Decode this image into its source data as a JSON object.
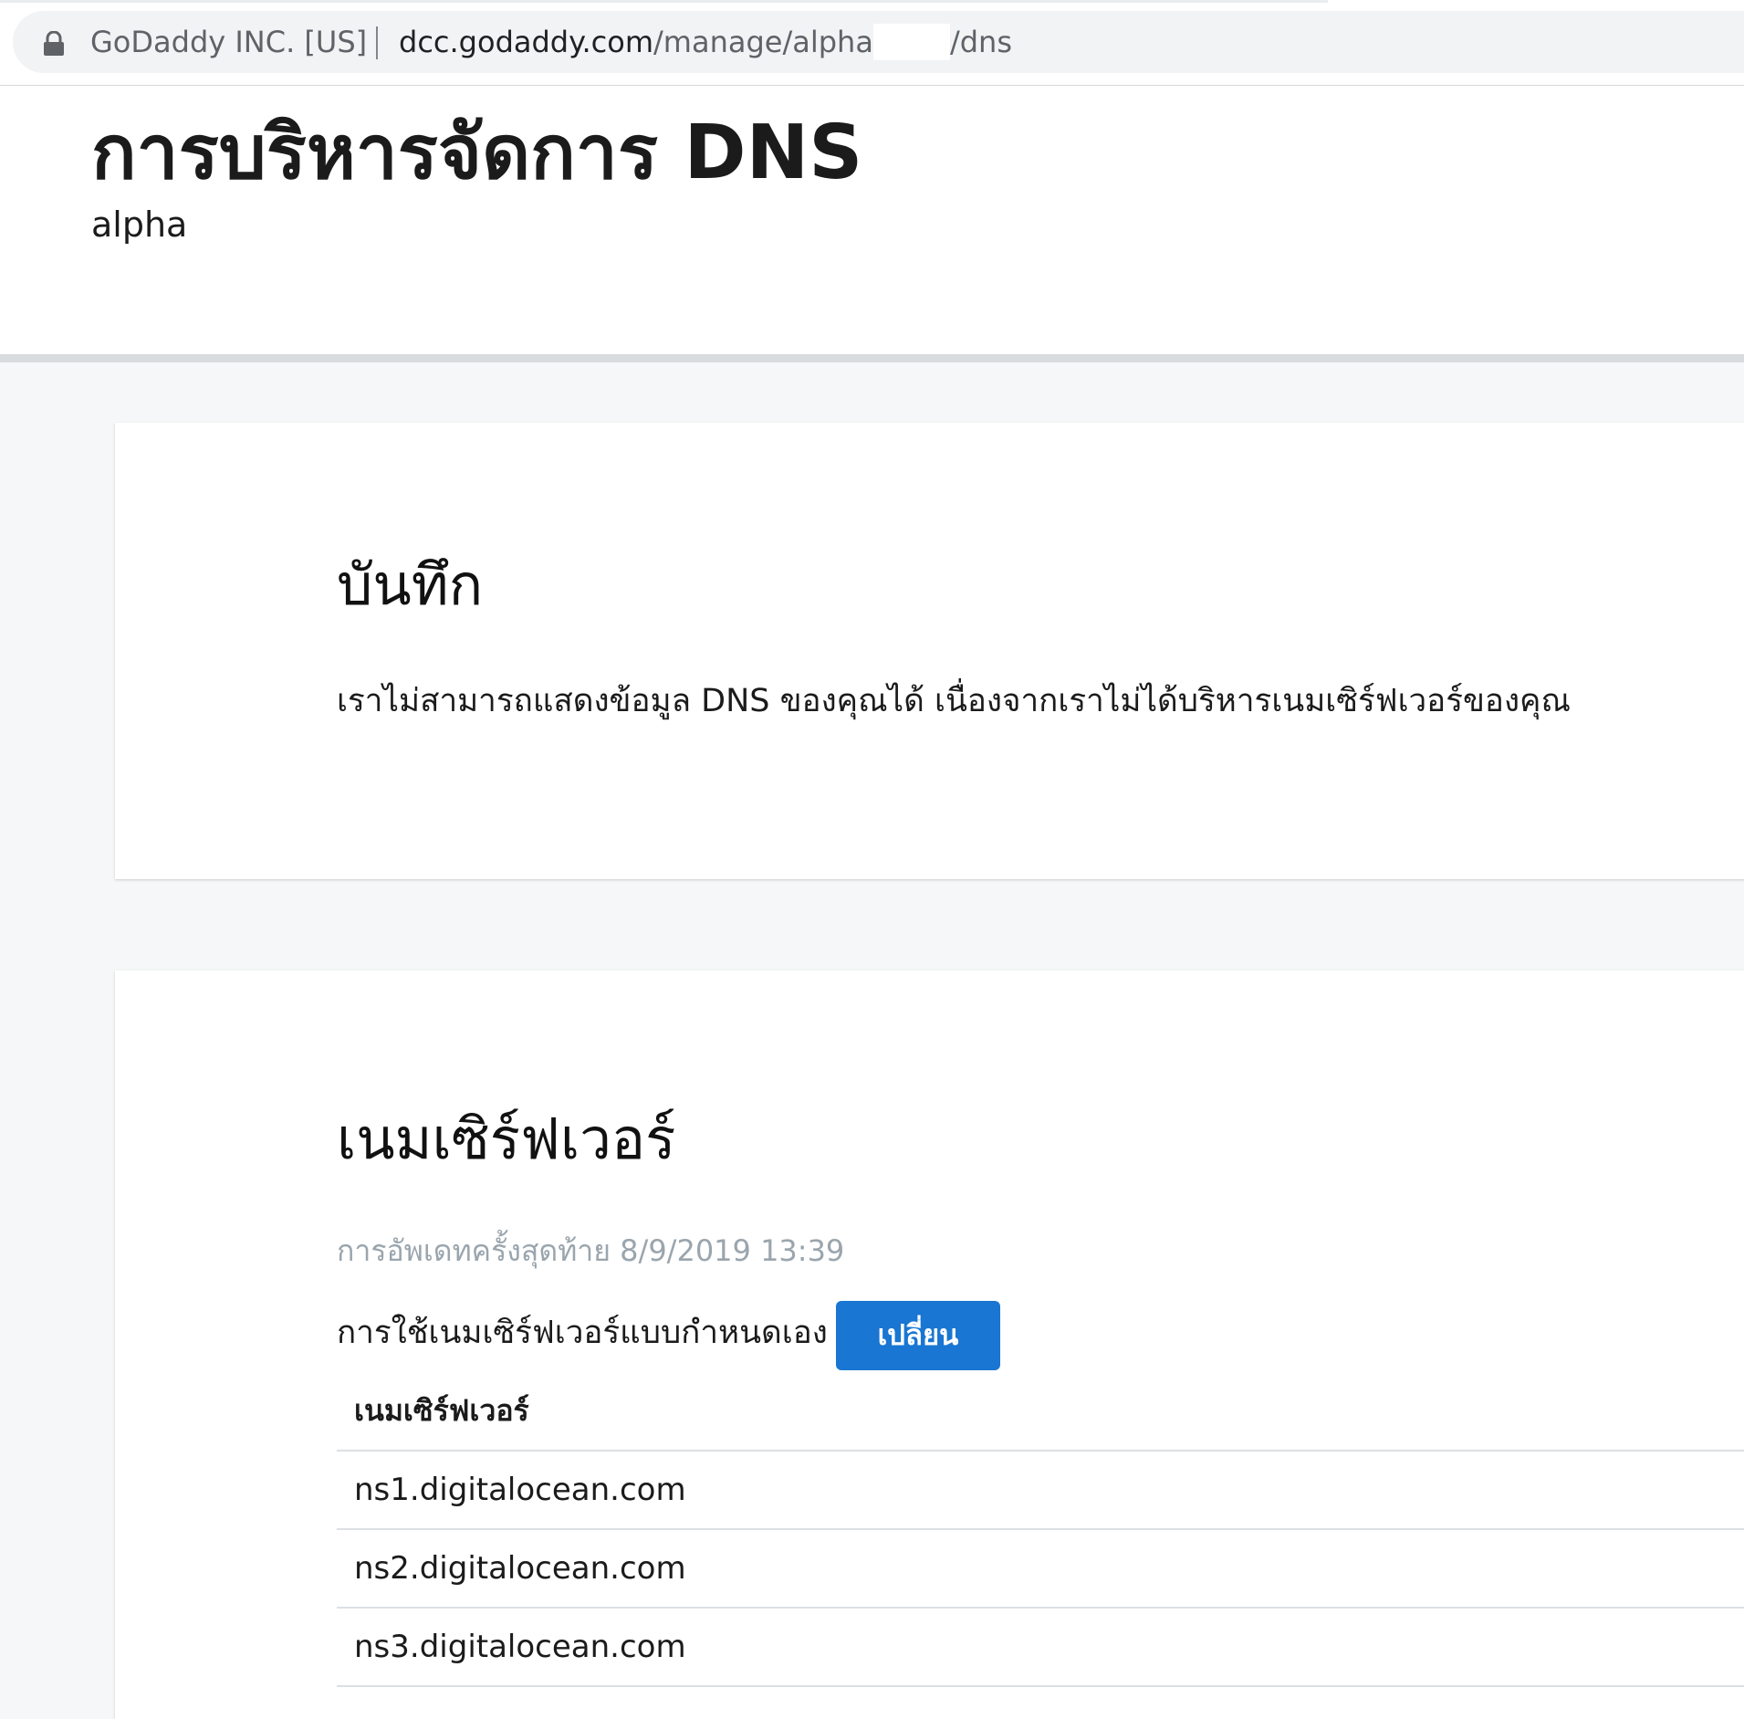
{
  "browser": {
    "site_owner": "GoDaddy INC. [US]",
    "url_host": "dcc.godaddy.com",
    "url_path_prefix": "/manage/alpha",
    "url_path_suffix": "/dns",
    "lock_icon": "lock-icon"
  },
  "header": {
    "title": "การบริหารจัดการ DNS",
    "subtitle": "alpha"
  },
  "note_card": {
    "heading": "บันทึก",
    "message": "เราไม่สามารถแสดงข้อมูล DNS ของคุณได้ เนื่องจากเราไม่ได้บริหารเนมเซิร์ฟเวอร์ของคุณ"
  },
  "nameserver_card": {
    "heading": "เนมเซิร์ฟเวอร์",
    "last_updated": "การอัพเดทครั้งสุดท้าย 8/9/2019 13:39",
    "custom_label": "การใช้เนมเซิร์ฟเวอร์แบบกำหนดเอง",
    "change_button": "เปลี่ยน",
    "table_header": "เนมเซิร์ฟเวอร์",
    "rows": [
      "ns1.digitalocean.com",
      "ns2.digitalocean.com",
      "ns3.digitalocean.com"
    ]
  },
  "colors": {
    "accent_button": "#1976d2",
    "page_background": "#f5f7f8",
    "muted_text": "#9aa5ad"
  }
}
